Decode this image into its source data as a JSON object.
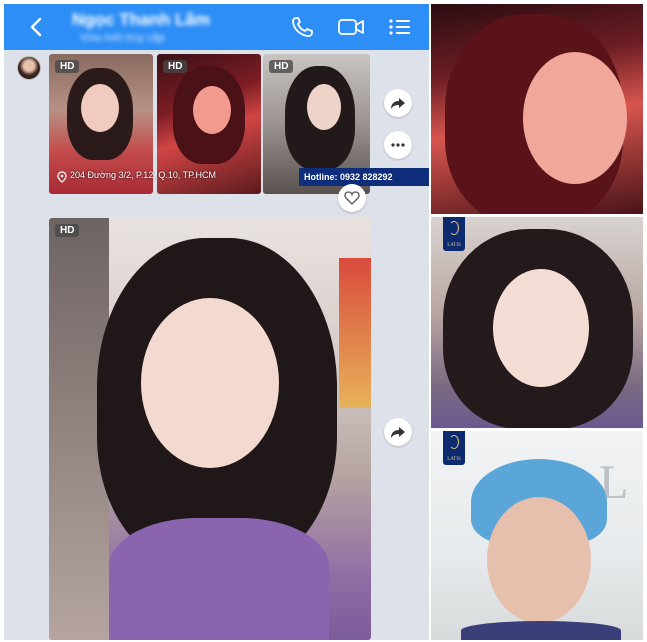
{
  "chat": {
    "header": {
      "contact_name": "Ngọc Thanh Lâm",
      "status": "Vừa mới truy cập",
      "bg_color": "#2d8ef5"
    },
    "icons": [
      "back-arrow-icon",
      "phone-icon",
      "video-call-icon",
      "menu-list-icon",
      "share-icon",
      "more-options-icon",
      "heart-icon",
      "location-pin-icon"
    ],
    "album": {
      "badges": [
        "HD",
        "HD",
        "HD"
      ],
      "address": "204 Đường 3/2, P.12, Q.10, TP.HCM",
      "hotline": "Hotline: 0932 828292"
    },
    "single_photo": {
      "badge": "HD"
    }
  },
  "right_column": {
    "brand": "LATIS",
    "brand_color": "#0d2a6e"
  }
}
